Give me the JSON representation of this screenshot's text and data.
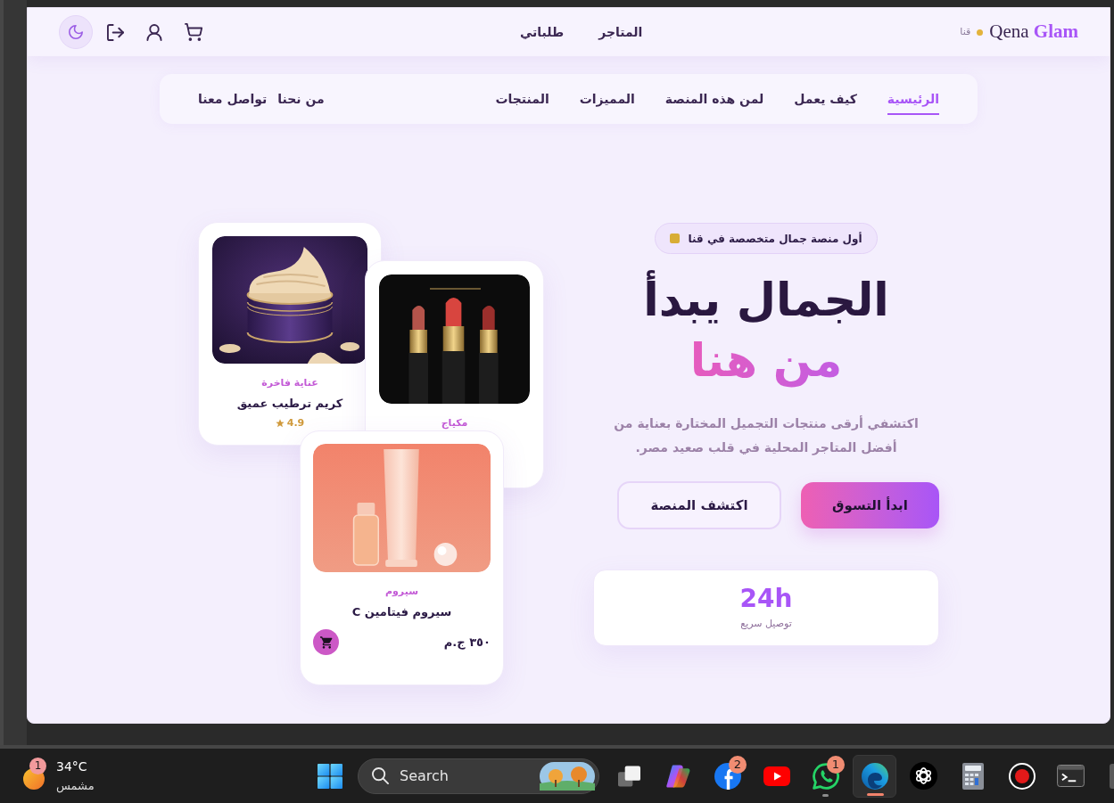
{
  "header": {
    "logo": "Qena **Glam**",
    "city": "قنا",
    "links": [
      {
        "label": "المتاجر"
      },
      {
        "label": "طلباتي"
      }
    ]
  },
  "nav": {
    "main_items": [
      {
        "label": "الرئيسية",
        "selected": true
      },
      {
        "label": "كيف يعمل",
        "selected": false
      },
      {
        "label": "لمن هذه المنصة",
        "selected": false
      },
      {
        "label": "المميزات",
        "selected": false
      },
      {
        "label": "المنتجات",
        "selected": false
      }
    ],
    "side_items": [
      {
        "label": "من نحنا",
        "selected": false
      },
      {
        "label": "تواصل معنا",
        "selected": false
      }
    ]
  },
  "hero": {
    "badge": "أول منصة جمال متخصصة في قنا",
    "title_line_1": "الجمال يبدأ",
    "title_line_2": "من هنا",
    "description": "اكتشفي أرقى منتجات التجميل المختارة بعناية من أفضل المتاجر المحلية في قلب صعيد مصر.",
    "buttons": [
      {
        "label": "ابدأ التسوق",
        "kind": "primary"
      },
      {
        "label": "اكتشف المنصة",
        "kind": "outline"
      }
    ],
    "stats": [
      {
        "value": "24h",
        "label": "توصيل سريع"
      }
    ]
  },
  "products": [
    {
      "category": "مكياج"
    },
    {
      "category": "عناية فاخرة",
      "name": "كريم ترطيب عميق",
      "rating": "4.9"
    },
    {
      "category": "سيروم",
      "name": "سيروم فيتامين C",
      "price": "٣٥٠ ج.م"
    }
  ],
  "taskbar": {
    "weather": {
      "temperature": "34°C",
      "condition": "مشمس",
      "badge": "1"
    },
    "search": {
      "placeholder": "Search"
    },
    "apps": [
      {
        "kind": "tile",
        "open": false,
        "active": false
      },
      {
        "kind": "terminal",
        "open": false,
        "active": false
      },
      {
        "kind": "record",
        "open": false,
        "active": false
      },
      {
        "kind": "calculator",
        "open": false,
        "active": false
      },
      {
        "kind": "knot",
        "open": false,
        "active": false
      },
      {
        "kind": "swirl",
        "open": true,
        "active": true
      },
      {
        "kind": "chat",
        "open": true,
        "active": false,
        "badge": "1"
      },
      {
        "kind": "play",
        "open": false,
        "active": false
      },
      {
        "kind": "f-logo",
        "open": false,
        "active": false,
        "badge": "2"
      },
      {
        "kind": "ribbon",
        "open": false,
        "active": false
      },
      {
        "kind": "squares",
        "open": false,
        "active": false
      }
    ]
  }
}
